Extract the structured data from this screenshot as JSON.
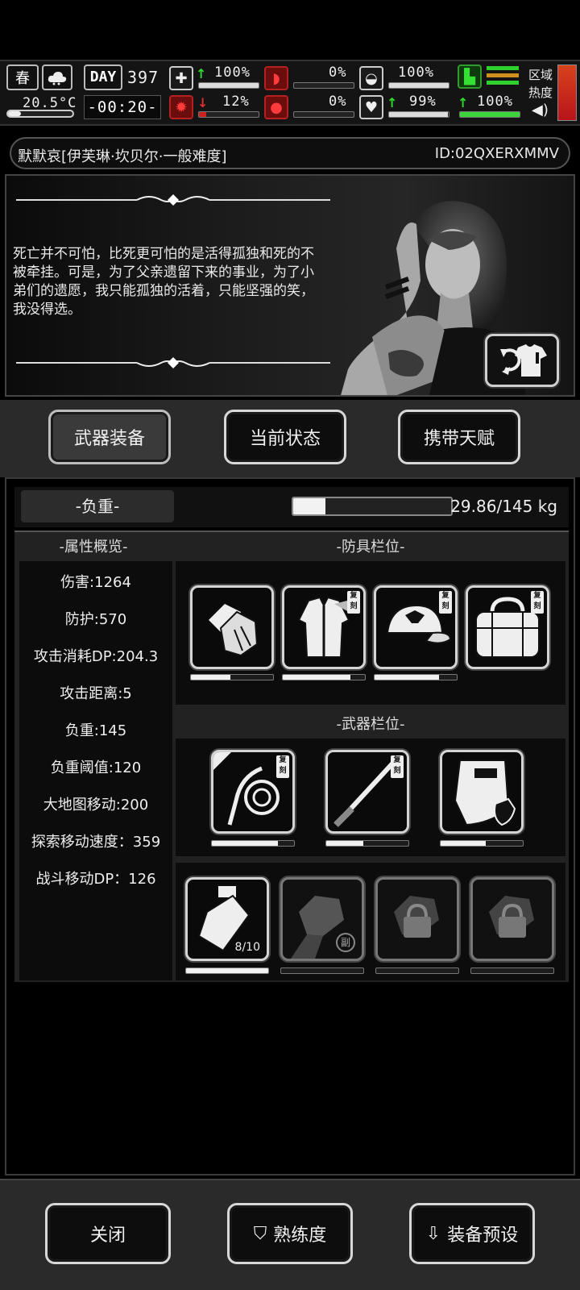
{
  "status": {
    "season": "春",
    "day_label": "DAY",
    "day": "397",
    "temperature": "20.5°C",
    "clock": "-00:20-",
    "health_pct": "100%",
    "hunger_pct": "0%",
    "thirst_pct": "100%",
    "infection_pct": "12%",
    "bleed_pct": "0%",
    "mood_pct": "99%",
    "stamina_pct": "100%",
    "zone_label_1": "区域",
    "zone_label_2": "热度"
  },
  "character": {
    "name": "默默哀[伊芙琳·坎贝尔·一般难度]",
    "id": "ID:02QXERXMMV",
    "quote": "死亡并不可怕，比死更可怕的是活得孤独和死的不被牵挂。可是，为了父亲遗留下来的事业，为了小弟们的遗愿，我只能孤独的活着，只能坚强的笑，我没得选。"
  },
  "tabs": {
    "weapons": "武器装备",
    "status": "当前状态",
    "talents": "携带天赋"
  },
  "weight": {
    "label": "-负重-",
    "value": "29.86/145 kg",
    "fraction": 0.206
  },
  "attributes": {
    "header": "-属性概览-",
    "items": [
      "伤害:1264",
      "防护:570",
      "攻击消耗DP:204.3",
      "攻击距离:5",
      "负重:145",
      "负重阈值:120",
      "大地图移动:200",
      "探索移动速度：359",
      "战斗移动DP：126"
    ]
  },
  "armor": {
    "header": "-防具栏位-",
    "slots": [
      {
        "icon": "gloves-icon",
        "durability": 0.48,
        "copy": false
      },
      {
        "icon": "jacket-icon",
        "durability": 0.82,
        "copy": true
      },
      {
        "icon": "cap-icon",
        "durability": 0.78,
        "copy": true
      },
      {
        "icon": "bag-icon",
        "durability": 0.0,
        "copy": true
      }
    ]
  },
  "weapons": {
    "header": "-武器栏位-",
    "slots": [
      {
        "icon": "whip-icon",
        "durability": 0.8,
        "copy": true
      },
      {
        "icon": "spear-icon",
        "durability": 0.45,
        "copy": true
      },
      {
        "icon": "riot-shield-icon",
        "durability": 0.55,
        "copy": false
      }
    ]
  },
  "quick": {
    "count": "8/10",
    "sub_label": "副",
    "copy_label": "复刻"
  },
  "bottom": {
    "close": "关闭",
    "proficiency": "熟练度",
    "preset": "装备预设"
  }
}
